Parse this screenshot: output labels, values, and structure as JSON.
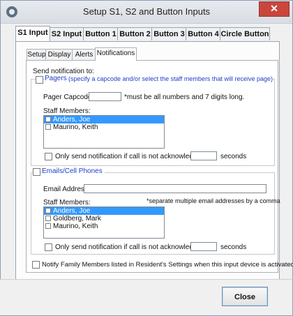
{
  "window": {
    "title": "Setup S1, S2 and Button Inputs",
    "close_glyph": "✕"
  },
  "main_tabs": [
    "S1 Input",
    "S2 Input",
    "Button 1",
    "Button 2",
    "Button 3",
    "Button 4",
    "Circle Button"
  ],
  "sub_tabs": [
    "Setup",
    "Display",
    "Alerts",
    "Notifications"
  ],
  "notifications": {
    "send_label": "Send notification to:",
    "pagers": {
      "label": "Pagers",
      "hint": "(specify a capcode and/or select the staff members that will receive page)",
      "capcode_label": "Pager Capcode:",
      "capcode_value": "",
      "capcode_note": "*must be all numbers and 7 digits long.",
      "staff_label": "Staff Members:",
      "staff": [
        "Anders, Joe",
        "Maurino, Keith"
      ],
      "only_send_label": "Only send notification if call is not acknowledged in",
      "seconds_value": "",
      "seconds_label": "seconds"
    },
    "emails": {
      "label": "Emails/Cell Phones",
      "email_label": "Email Address:",
      "email_value": "",
      "email_note": "*separate multiple email addresses by a comma",
      "staff_label": "Staff Members:",
      "staff": [
        "Anders, Joe",
        "Goldberg, Mark",
        "Maurino, Keith"
      ],
      "only_send_label": "Only send notification if call is not acknowledged in",
      "seconds_value": "",
      "seconds_label": "seconds"
    },
    "family_label": "Notify Family Members listed in Resident's Settings when this input device is activated"
  },
  "footer": {
    "close_label": "Close"
  },
  "colors": {
    "accent": "#1e3ec8",
    "selection": "#3399ff",
    "titlebar_close": "#c9463d"
  }
}
